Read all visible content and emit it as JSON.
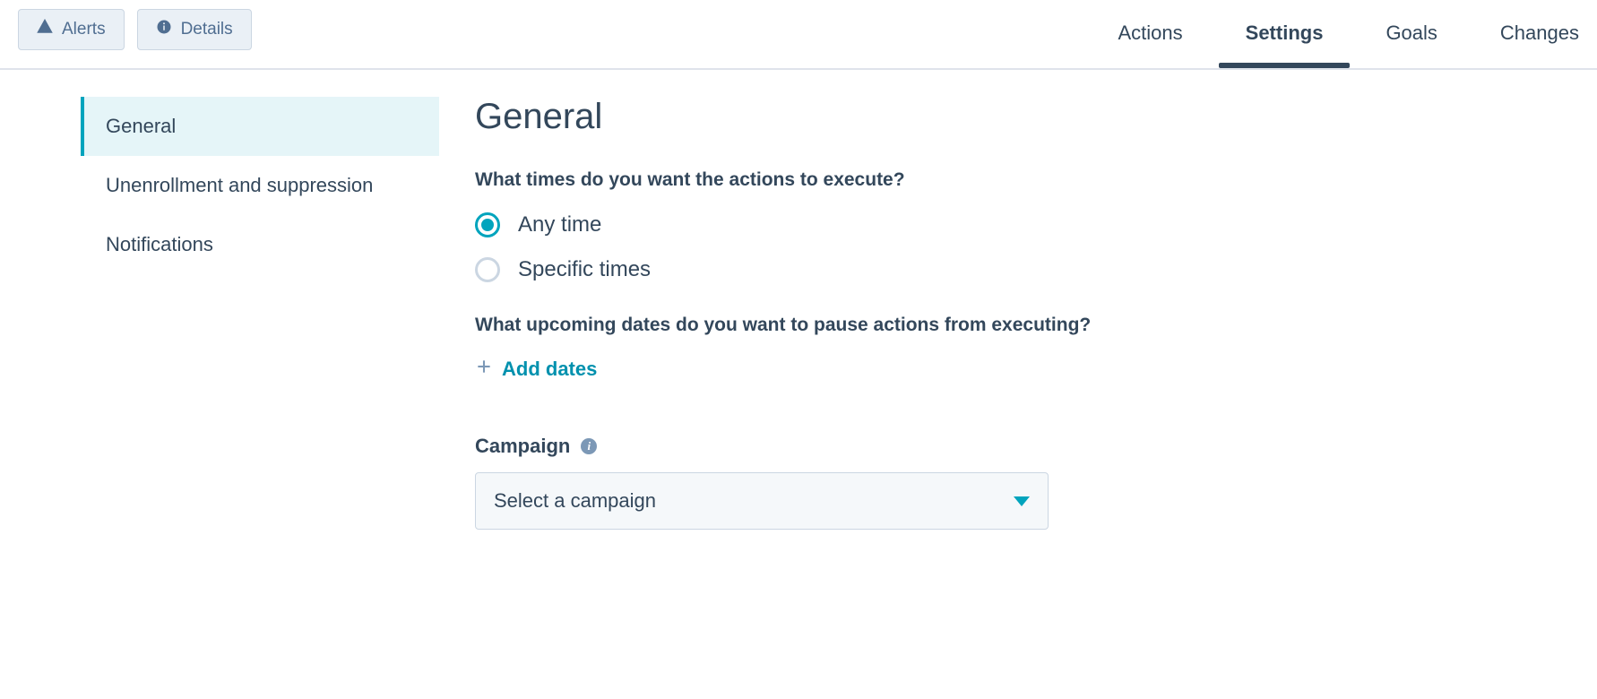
{
  "toolbar": {
    "alerts_label": "Alerts",
    "details_label": "Details"
  },
  "tabs": {
    "items": [
      {
        "label": "Actions"
      },
      {
        "label": "Settings"
      },
      {
        "label": "Goals"
      },
      {
        "label": "Changes"
      }
    ],
    "active": "Settings"
  },
  "sidenav": {
    "items": [
      {
        "label": "General"
      },
      {
        "label": "Unenrollment and suppression"
      },
      {
        "label": "Notifications"
      }
    ],
    "active": "General"
  },
  "main": {
    "page_title": "General",
    "question_times": "What times do you want the actions to execute?",
    "radio_any_time": "Any time",
    "radio_specific_times": "Specific times",
    "radio_selected": "Any time",
    "question_pause": "What upcoming dates do you want to pause actions from executing?",
    "add_dates_label": "Add dates",
    "campaign_label": "Campaign",
    "campaign_select_placeholder": "Select a campaign"
  }
}
